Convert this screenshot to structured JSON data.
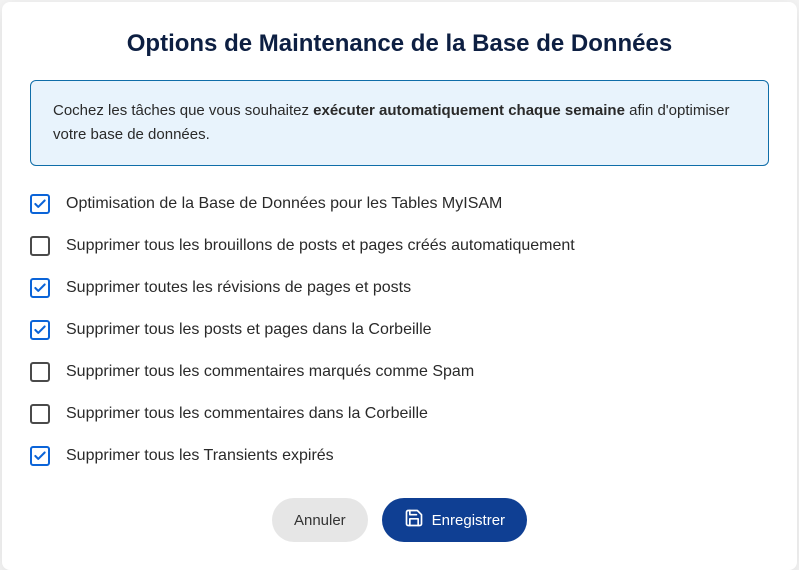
{
  "title": "Options de Maintenance de la Base de Données",
  "info": {
    "prefix": "Cochez les tâches que vous souhaitez ",
    "bold": "exécuter automatiquement chaque semaine",
    "suffix": " afin d'optimiser votre base de données."
  },
  "options": [
    {
      "label": "Optimisation de la Base de Données pour les Tables MyISAM",
      "checked": true
    },
    {
      "label": "Supprimer tous les brouillons de posts et pages créés automatiquement",
      "checked": false
    },
    {
      "label": "Supprimer toutes les révisions de pages et posts",
      "checked": true
    },
    {
      "label": "Supprimer tous les posts et pages dans la Corbeille",
      "checked": true
    },
    {
      "label": "Supprimer tous les commentaires marqués comme Spam",
      "checked": false
    },
    {
      "label": "Supprimer tous les commentaires dans la Corbeille",
      "checked": false
    },
    {
      "label": "Supprimer tous les Transients expirés",
      "checked": true
    }
  ],
  "footer": {
    "cancel": "Annuler",
    "save": "Enregistrer"
  }
}
